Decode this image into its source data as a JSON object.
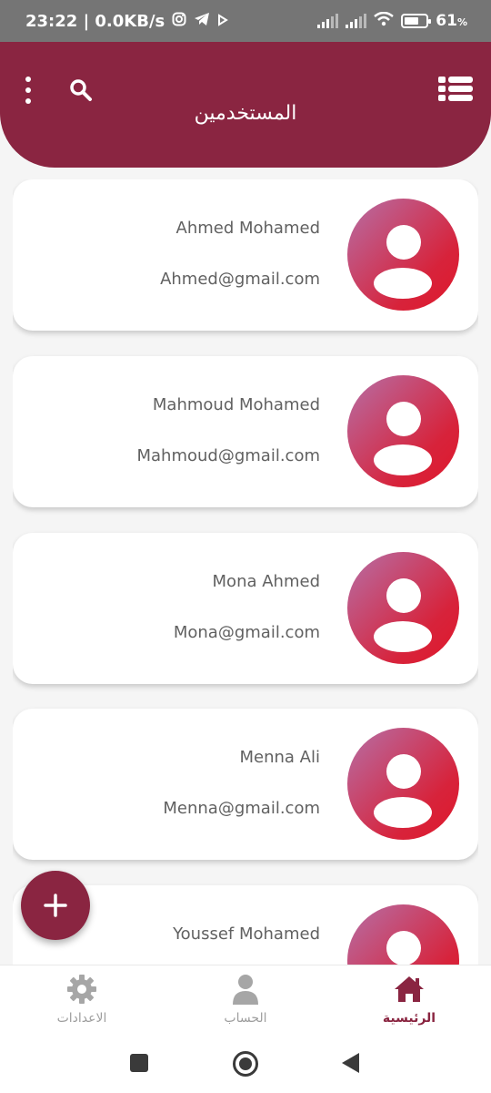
{
  "status_bar": {
    "time_speed": "23:22 | 0.0KB/s",
    "battery_percent": "61",
    "battery_unit": "%"
  },
  "app_bar": {
    "title": "المستخدمين"
  },
  "users": [
    {
      "name": "Ahmed Mohamed",
      "email": "Ahmed@gmail.com"
    },
    {
      "name": "Mahmoud Mohamed",
      "email": "Mahmoud@gmail.com"
    },
    {
      "name": "Mona Ahmed",
      "email": "Mona@gmail.com"
    },
    {
      "name": "Menna Ali",
      "email": "Menna@gmail.com"
    },
    {
      "name": "Youssef Mohamed",
      "email": ""
    }
  ],
  "bottom_nav": {
    "settings_label": "الاعدادات",
    "account_label": "الحساب",
    "home_label": "الرئيسية"
  },
  "colors": {
    "primary": "#8a2541",
    "avatar_gradient_start": "#b66fa6",
    "avatar_gradient_end": "#e0182b"
  }
}
